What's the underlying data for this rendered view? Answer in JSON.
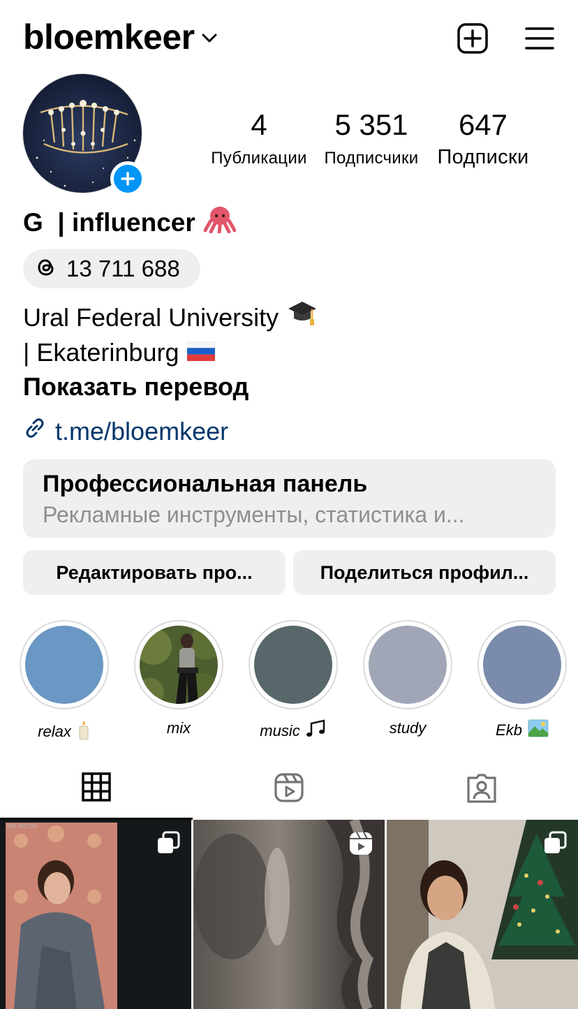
{
  "header": {
    "username": "bloemkeer",
    "chevron_icon": "chevron-down-icon",
    "add_icon": "plus-square-icon",
    "menu_icon": "hamburger-menu-icon"
  },
  "profile": {
    "stats": [
      {
        "value": "4",
        "label": "Публикации"
      },
      {
        "value": "5 351",
        "label": "Подписчики"
      },
      {
        "value": "647",
        "label": "Подписки"
      }
    ],
    "full_name": "G  | influencer",
    "name_emoji": "octopus-emoji",
    "threads_count": "13 711 688",
    "bio_line1": "Ural Federal University",
    "bio_line2": "| Ekaterinburg",
    "bio_emoji1": "graduation-cap-emoji",
    "bio_emoji2": "russia-flag-emoji",
    "translate_label": "Показать перевод",
    "link": "t.me/bloemkeer"
  },
  "pro_panel": {
    "title": "Профессиональная панель",
    "subtitle": "Рекламные инструменты, статистика и..."
  },
  "actions": {
    "edit_label": "Редактировать про...",
    "share_label": "Поделиться профил..."
  },
  "highlights": [
    {
      "label": "relax",
      "emoji": "candle-emoji",
      "color": "#6a97c3"
    },
    {
      "label": "mix",
      "emoji": "",
      "color": "#5b6b3f"
    },
    {
      "label": "music",
      "emoji": "music-notes-emoji",
      "color": "#58686a"
    },
    {
      "label": "study",
      "emoji": "",
      "color": "#a0a6b6"
    },
    {
      "label": "Ekb",
      "emoji": "landscape-emoji",
      "color": "#7a8bab"
    }
  ],
  "tabs": [
    "grid-icon",
    "reels-icon",
    "tagged-icon"
  ],
  "colors": {
    "accent_blue": "#0095f6",
    "link_blue": "#00376b",
    "pill_bg": "#efefef",
    "muted_text": "#8e8e8e"
  }
}
